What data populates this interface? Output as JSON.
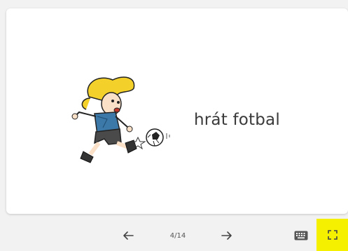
{
  "slide": {
    "text": "hrát fotbal",
    "illustration_icon": "girl-kicking-soccer-ball-illustration"
  },
  "navigation": {
    "prev_icon": "arrow-left-icon",
    "next_icon": "arrow-right-icon",
    "counter": "4/14",
    "keyboard_icon": "keyboard-icon",
    "fullscreen_icon": "fullscreen-icon",
    "highlight_color": "#f5f000"
  }
}
